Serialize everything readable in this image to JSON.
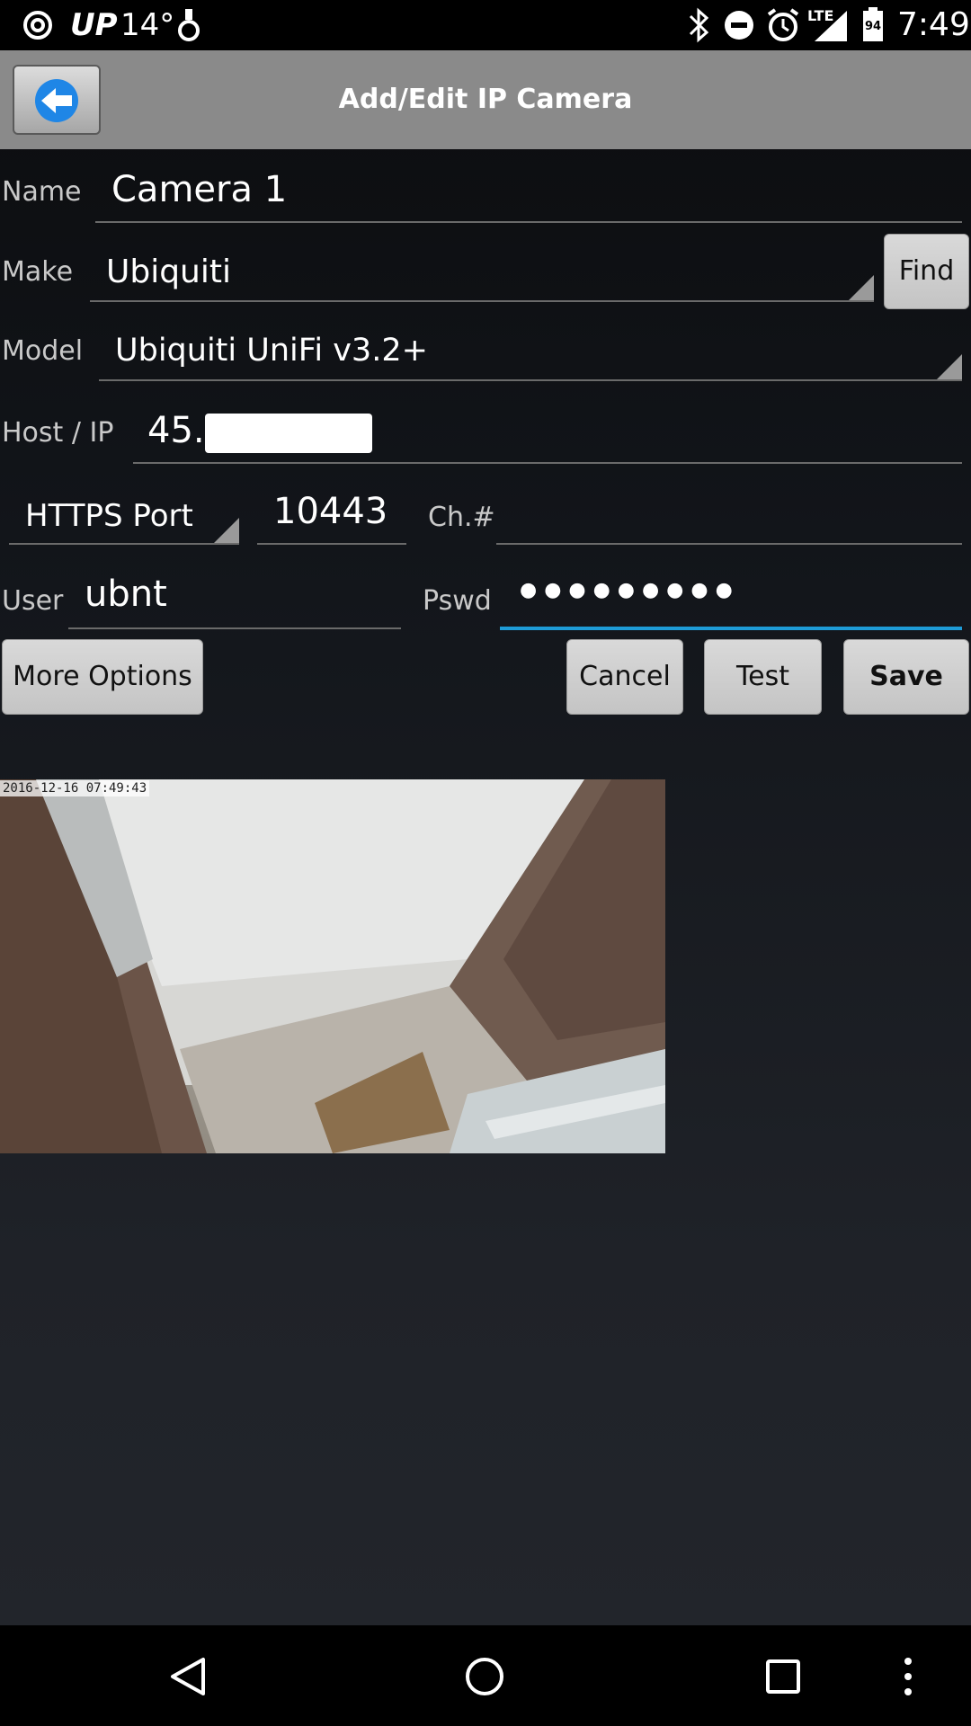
{
  "status_bar": {
    "carrier_badge": "UP",
    "temperature": "14°",
    "battery_level": "94",
    "network": "LTE",
    "time": "7:49"
  },
  "header": {
    "title": "Add/Edit IP Camera"
  },
  "form": {
    "name": {
      "label": "Name",
      "value": "Camera 1"
    },
    "make": {
      "label": "Make",
      "value": "Ubiquiti",
      "find_button": "Find"
    },
    "model": {
      "label": "Model",
      "value": "Ubiquiti UniFi v3.2+"
    },
    "host": {
      "label": "Host / IP",
      "value": "45."
    },
    "port": {
      "type": "HTTPS Port",
      "value": "10443",
      "channel_label": "Ch.#",
      "channel_value": ""
    },
    "user": {
      "label": "User",
      "value": "ubnt"
    },
    "password": {
      "label": "Pswd",
      "masked_value": "●●●●●●●●●"
    }
  },
  "buttons": {
    "more_options": "More Options",
    "cancel": "Cancel",
    "test": "Test",
    "save": "Save"
  },
  "preview": {
    "timestamp": "2016-12-16 07:49:43"
  },
  "colors": {
    "focus_underline": "#1e9bd7",
    "title_bar": "#8a8a8a",
    "back_arrow": "#1f86e6"
  }
}
